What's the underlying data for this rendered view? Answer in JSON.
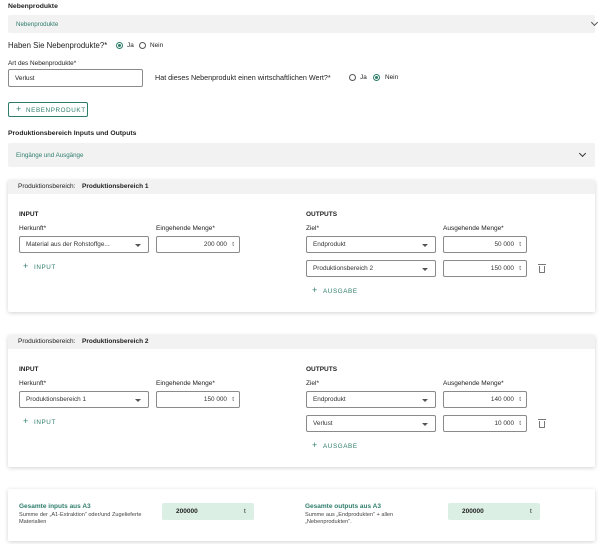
{
  "byproducts": {
    "section_title": "Nebenprodukte",
    "accordion_label": "Nebenprodukte",
    "question": "Haben Sie Nebenprodukte?*",
    "yes": "Ja",
    "no": "Nein",
    "has_byproducts": "Ja",
    "type_label": "Art des Nebenprodukte*",
    "type_value": "Verlust",
    "value_question": "Hat dieses Nebenprodukt einen wirtschaftlichen Wert?*",
    "value_yes": "Ja",
    "value_no": "Nein",
    "has_value": "Nein",
    "add_button": "NEBENPRODUKT"
  },
  "production": {
    "section_title": "Produktionsbereich Inputs und Outputs",
    "accordion_label": "Eingänge und Ausgänge",
    "areas": [
      {
        "header_label": "Produktionsbereich:",
        "header_name": "Produktionsbereich 1",
        "input_title": "INPUT",
        "origin_label": "Herkunft*",
        "incoming_label": "Eingehende Menge*",
        "input_origin": "Material aus der Rohstoffge...",
        "input_amount": "200 000",
        "unit": "t",
        "add_input": "INPUT",
        "outputs_title": "OUTPUTS",
        "target_label": "Ziel*",
        "outgoing_label": "Ausgehende Menge*",
        "outputs": [
          {
            "target": "Endprodukt",
            "amount": "50 000",
            "unit": "t"
          },
          {
            "target": "Produktionsbereich 2",
            "amount": "150 000",
            "unit": "t"
          }
        ],
        "add_output": "AUSGABE"
      },
      {
        "header_label": "Produktionsbereich:",
        "header_name": "Produktionsbereich 2",
        "input_title": "INPUT",
        "origin_label": "Herkunft*",
        "incoming_label": "Eingehende Menge*",
        "input_origin": "Produktionsbereich 1",
        "input_amount": "150 000",
        "unit": "t",
        "add_input": "INPUT",
        "outputs_title": "OUTPUTS",
        "target_label": "Ziel*",
        "outgoing_label": "Ausgehende Menge*",
        "outputs": [
          {
            "target": "Endprodukt",
            "amount": "140 000",
            "unit": "t"
          },
          {
            "target": "Verlust",
            "amount": "10 000",
            "unit": "t"
          }
        ],
        "add_output": "AUSGABE"
      }
    ]
  },
  "totals": {
    "inputs_title": "Gesamte inputs aus A3",
    "inputs_desc_1": "Summe der „A1-Extraktion“ oder/und Zugelieferte",
    "inputs_desc_2": "Materialien",
    "inputs_value": "200000",
    "outputs_title": "Gesamte outputs aus A3",
    "outputs_desc_1": "Summe aus „Endprodukten“ + allen",
    "outputs_desc_2": "„Nebenprodukten“.",
    "outputs_value": "200000",
    "unit": "t"
  },
  "colors": {
    "accent": "#2e7d6b",
    "panel": "#f2f2f2",
    "total_field": "#dcefe4"
  }
}
